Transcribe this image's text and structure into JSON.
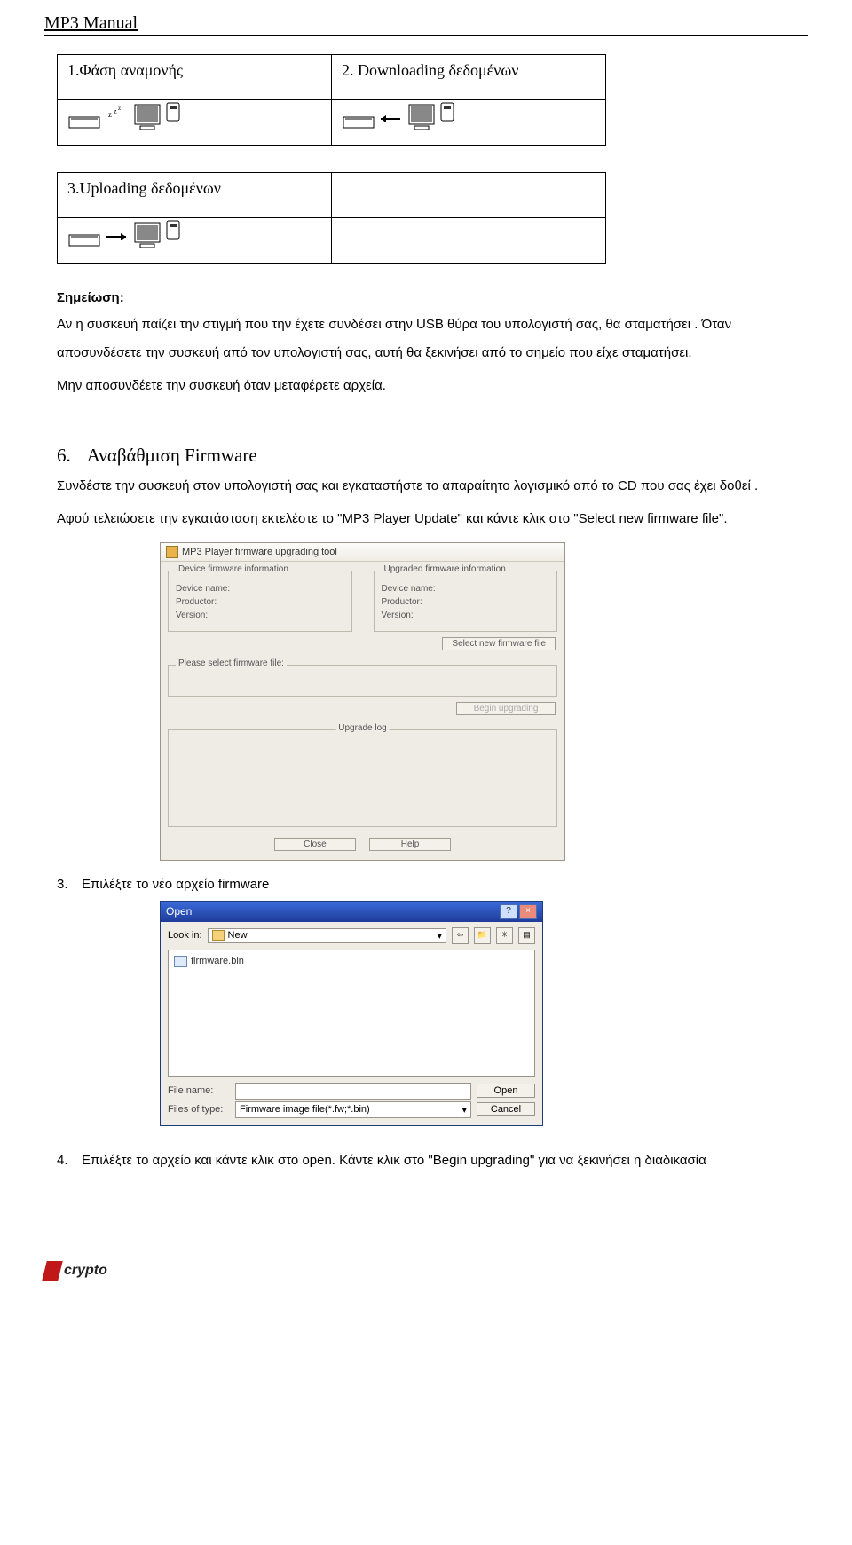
{
  "header": {
    "title": "MP3 Manual"
  },
  "phases": {
    "waiting_title": "1.Φάση αναμονής",
    "downloading_title": "2. Downloading δεδομένων",
    "uploading_title": "3.Uploading δεδομένων"
  },
  "note_label": "Σημείωση:",
  "note_body_1": "Αν η συσκευή παίζει την στιγμή που την έχετε συνδέσει στην USB θύρα του υπολογιστή σας, θα σταματήσει . Όταν αποσυνδέσετε την συσκευή από τον υπολογιστή σας, αυτή θα ξεκινήσει από το σημείο που είχε σταματήσει.",
  "note_body_2": "Μην αποσυνδέετε την συσκευή όταν μεταφέρετε αρχεία.",
  "section6": {
    "num": "6.",
    "title": "Αναβάθμιση Firmware",
    "p1": "Συνδέστε την συσκευή στον υπολογιστή σας και εγκαταστήστε το απαραίτητο λογισμικό από το CD που σας έχει δοθεί .",
    "p2": "Αφού τελειώσετε την εγκατάσταση εκτελέστε το \"MP3 Player Update\" και κάντε κλικ στο \"Select new firmware file\"."
  },
  "fw_tool": {
    "title": "MP3 Player firmware upgrading tool",
    "left_legend": "Device firmware information",
    "right_legend": "Upgraded firmware information",
    "device_name": "Device name:",
    "productor": "Productor:",
    "version": "Version:",
    "select_btn": "Select new firmware file",
    "select_legend": "Please select firmware file:",
    "begin_btn": "Begin upgrading",
    "log_legend": "Upgrade log",
    "close_btn": "Close",
    "help_btn": "Help"
  },
  "step3": {
    "n": "3.",
    "text": "Επιλέξτε το νέο αρχείο firmware"
  },
  "open_dlg": {
    "title": "Open",
    "look_in": "Look in:",
    "folder": "New",
    "file": "firmware.bin",
    "file_name_lbl": "File name:",
    "file_type_lbl": "Files of type:",
    "file_type_val": "Firmware image file(*.fw;*.bin)",
    "open_btn": "Open",
    "cancel_btn": "Cancel"
  },
  "step4": {
    "n": "4.",
    "text": "Επιλέξτε το αρχείο και κάντε κλικ στο open. Κάντε κλικ στο \"Begin upgrading\" για να ξεκινήσει η διαδικασία"
  },
  "footer": {
    "brand": "crypto"
  }
}
